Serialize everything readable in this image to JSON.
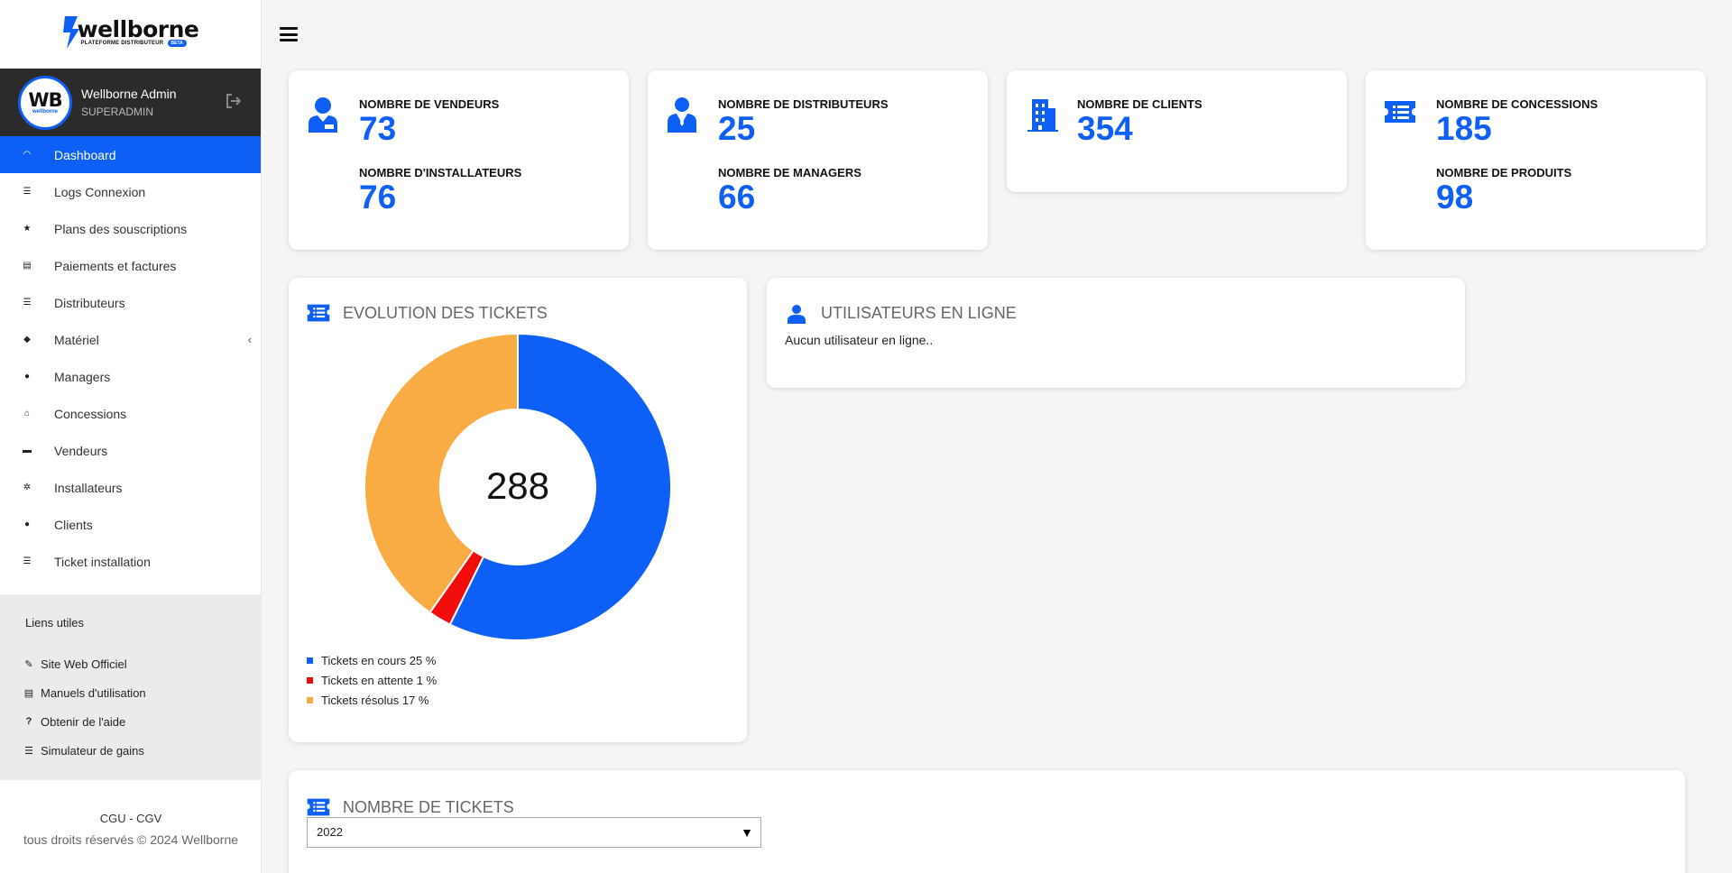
{
  "brand": {
    "name": "wellborne",
    "sub": "PLATEFORME DISTRIBUTEUR",
    "badge": "BETA"
  },
  "user": {
    "avatar_text": "WB",
    "avatar_sub": "wellborne",
    "name": "Wellborne Admin",
    "role": "SUPERADMIN"
  },
  "nav": {
    "items": [
      {
        "label": "Dashboard",
        "icon": "dashboard-icon",
        "active": true
      },
      {
        "label": "Logs Connexion",
        "icon": "list-icon"
      },
      {
        "label": "Plans des souscriptions",
        "icon": "star-icon"
      },
      {
        "label": "Paiements et factures",
        "icon": "invoice-icon"
      },
      {
        "label": "Distributeurs",
        "icon": "list-icon"
      },
      {
        "label": "Matériel",
        "icon": "router-icon",
        "has_children": true
      },
      {
        "label": "Managers",
        "icon": "users-icon"
      },
      {
        "label": "Concessions",
        "icon": "home-icon"
      },
      {
        "label": "Vendeurs",
        "icon": "card-icon"
      },
      {
        "label": "Installateurs",
        "icon": "gear-icon"
      },
      {
        "label": "Clients",
        "icon": "user-icon"
      },
      {
        "label": "Ticket installation",
        "icon": "list-icon"
      }
    ]
  },
  "useful_links": {
    "title": "Liens utiles",
    "items": [
      {
        "label": "Site Web Officiel",
        "icon": "paperclip-icon"
      },
      {
        "label": "Manuels d'utilisation",
        "icon": "manual-icon"
      },
      {
        "label": "Obtenir de l'aide",
        "icon": "question-icon"
      },
      {
        "label": "Simulateur de gains",
        "icon": "list-icon"
      }
    ]
  },
  "footer": {
    "cgu": "CGU - CGV",
    "copyright": "tous droits réservés © 2024 Wellborne"
  },
  "stats": {
    "vendeurs": {
      "label": "NOMBRE DE VENDEURS",
      "value": "73"
    },
    "installateurs": {
      "label": "NOMBRE D'INSTALLATEURS",
      "value": "76"
    },
    "distributeurs": {
      "label": "NOMBRE DE DISTRIBUTEURS",
      "value": "25"
    },
    "managers": {
      "label": "NOMBRE DE MANAGERS",
      "value": "66"
    },
    "clients": {
      "label": "NOMBRE DE CLIENTS",
      "value": "354"
    },
    "concessions": {
      "label": "NOMBRE DE CONCESSIONS",
      "value": "185"
    },
    "produits": {
      "label": "NOMBRE DE PRODUITS",
      "value": "98"
    }
  },
  "tickets_panel": {
    "title": "EVOLUTION DES TICKETS",
    "center_total": "288",
    "legend": [
      "Tickets en cours 25 %",
      "Tickets en attente 1 %",
      "Tickets résolus 17 %"
    ]
  },
  "chart_data": {
    "type": "pie",
    "title": "",
    "categories": [
      "Tickets en cours",
      "Tickets en attente",
      "Tickets résolus"
    ],
    "values": [
      165,
      7,
      116
    ],
    "colors": [
      "#0d5ff5",
      "#f20d0d",
      "#f9ac44"
    ],
    "donut": true,
    "center_label": "288"
  },
  "online_panel": {
    "title": "UTILISATEURS EN LIGNE",
    "empty_text": "Aucun utilisateur en ligne.."
  },
  "tickets_count_panel": {
    "title": "NOMBRE DE TICKETS",
    "year_selected": "2022"
  },
  "colors": {
    "accent": "#0d5ff5",
    "sidebar_user_bg": "#2b2b2b",
    "pending": "#f20d0d",
    "resolved": "#f9ac44"
  }
}
